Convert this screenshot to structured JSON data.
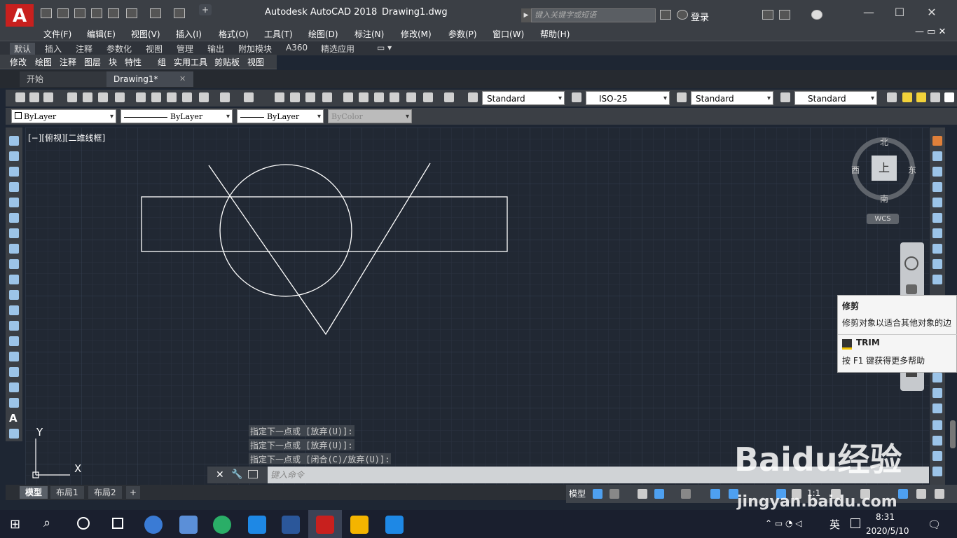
{
  "titlebar": {
    "app_title": "Autodesk AutoCAD 2018",
    "doc_title": "Drawing1.dwg",
    "search_placeholder": "键入关键字或短语",
    "login": "登录",
    "logo": "A"
  },
  "menu": [
    "文件(F)",
    "编辑(E)",
    "视图(V)",
    "插入(I)",
    "格式(O)",
    "工具(T)",
    "绘图(D)",
    "标注(N)",
    "修改(M)",
    "参数(P)",
    "窗口(W)",
    "帮助(H)"
  ],
  "ribbon_tabs": [
    "默认",
    "插入",
    "注释",
    "参数化",
    "视图",
    "管理",
    "输出",
    "附加模块",
    "A360",
    "精选应用"
  ],
  "ribbon_panels": [
    "修改",
    "绘图",
    "注释",
    "图层",
    "块",
    "特性",
    "组",
    "实用工具",
    "剪贴板",
    "视图"
  ],
  "file_tabs": {
    "start": "开始",
    "drawing": "Drawing1*"
  },
  "styles": {
    "text_style": "Standard",
    "dim_style": "ISO-25",
    "table_style": "Standard",
    "mleader_style": "Standard"
  },
  "properties": {
    "layer": "ByLayer",
    "linetype": "ByLayer",
    "lineweight": "ByLayer",
    "color": "ByColor"
  },
  "viewport_label": "[−][俯视][二维线框]",
  "viewcube": {
    "north": "北",
    "south": "南",
    "east": "东",
    "west": "西",
    "top": "上",
    "wcs": "WCS"
  },
  "ucs": {
    "x": "X",
    "y": "Y"
  },
  "tooltip": {
    "title": "修剪",
    "description": "修剪对象以适合其他对象的边",
    "command": "TRIM",
    "help": "按 F1 键获得更多帮助"
  },
  "command_history": [
    "指定下一点或 [放弃(U)]:",
    "指定下一点或 [放弃(U)]:",
    "指定下一点或 [闭合(C)/放弃(U)]:"
  ],
  "command_placeholder": "键入命令",
  "layout_tabs": [
    "模型",
    "布局1",
    "布局2"
  ],
  "status": {
    "model": "模型",
    "scale": "1:1"
  },
  "taskbar": {
    "time": "8:31",
    "date": "2020/5/10",
    "ime": "英"
  },
  "watermark": {
    "main": "Baidu经验",
    "sub": "jingyan.baidu.com"
  }
}
